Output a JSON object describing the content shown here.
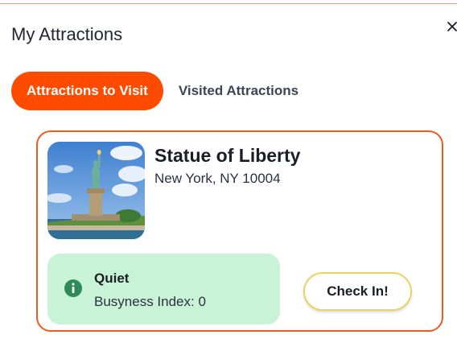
{
  "panel": {
    "title": "My Attractions",
    "close_icon": "close-icon"
  },
  "tabs": [
    {
      "label": "Attractions to Visit",
      "active": true
    },
    {
      "label": "Visited Attractions",
      "active": false
    }
  ],
  "attraction": {
    "name": "Statue of Liberty",
    "address": "New York, NY 10004",
    "image_icon": "statue-of-liberty-photo",
    "status": {
      "icon": "info-icon",
      "label": "Quiet",
      "busyness": "Busyness Index: 0"
    },
    "check_in_label": "Check In!"
  },
  "colors": {
    "accent": "#ff4b00",
    "card_border": "#f05a1d",
    "status_bg": "#c8f3d6",
    "status_icon": "#2e8b57",
    "button_border": "#ecd25e"
  }
}
